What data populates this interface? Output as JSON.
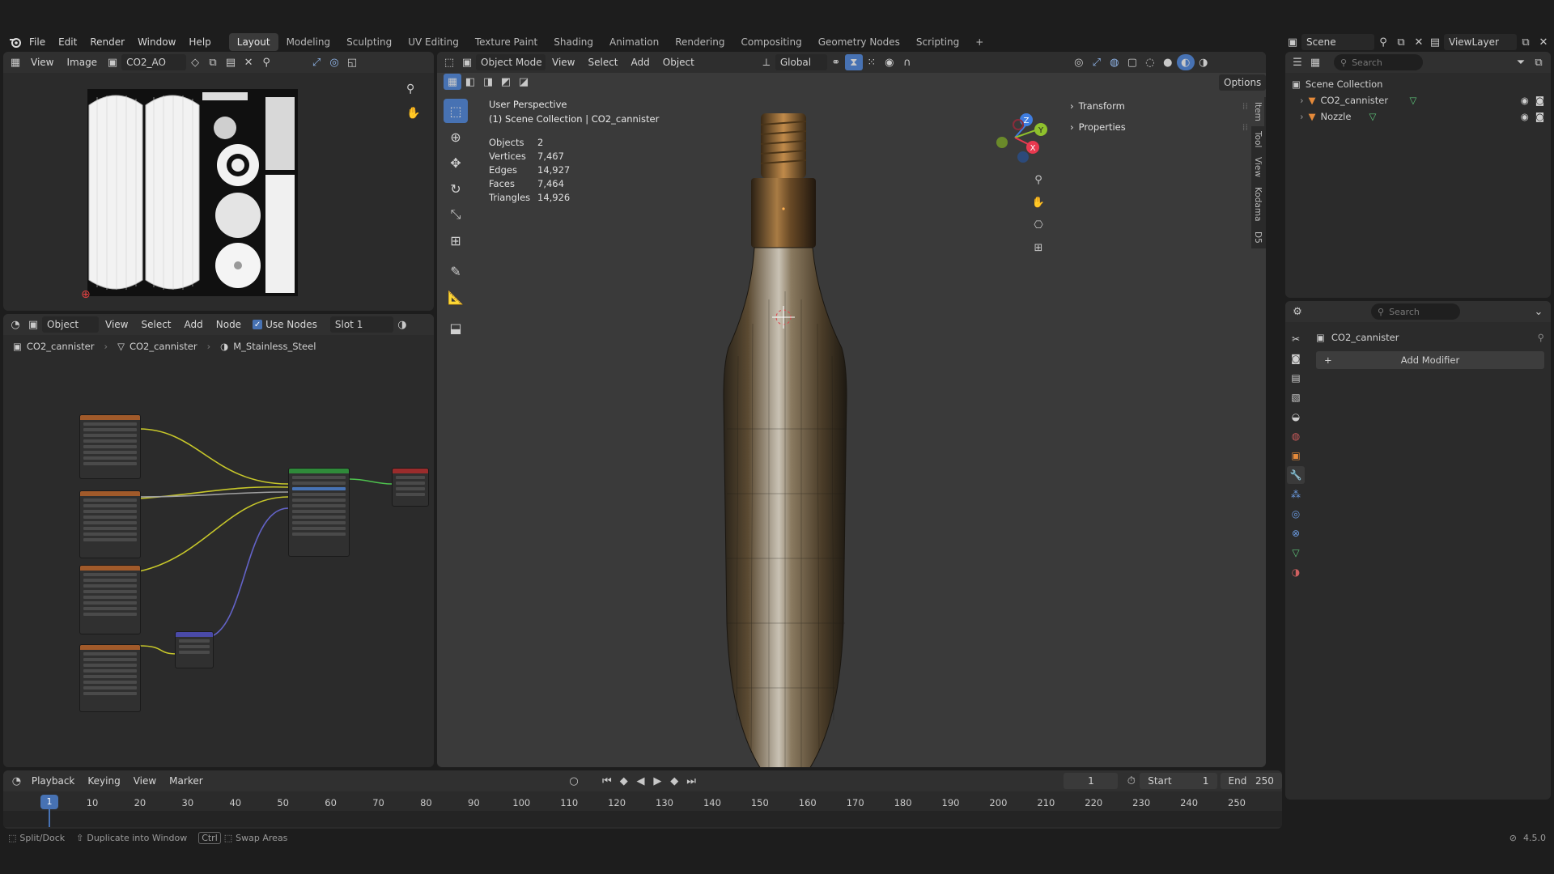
{
  "topbar": {
    "menus": [
      "File",
      "Edit",
      "Render",
      "Window",
      "Help"
    ],
    "workspaces": [
      "Layout",
      "Modeling",
      "Sculpting",
      "UV Editing",
      "Texture Paint",
      "Shading",
      "Animation",
      "Rendering",
      "Compositing",
      "Geometry Nodes",
      "Scripting"
    ],
    "active_workspace": "Layout",
    "scene_label": "Scene",
    "viewlayer_label": "ViewLayer"
  },
  "image_editor": {
    "menus": [
      "View",
      "Image"
    ],
    "image_name": "CO2_AO"
  },
  "node_editor": {
    "object_mode": "Object",
    "menus": [
      "View",
      "Select",
      "Add",
      "Node"
    ],
    "use_nodes_label": "Use Nodes",
    "use_nodes_checked": true,
    "slot": "Slot 1",
    "breadcrumb": [
      "CO2_cannister",
      "CO2_cannister",
      "M_Stainless_Steel"
    ]
  },
  "viewport": {
    "mode": "Object Mode",
    "menus": [
      "View",
      "Select",
      "Add",
      "Object"
    ],
    "transform_orientation": "Global",
    "options_label": "Options",
    "perspective_label": "User Perspective",
    "collection_label": "(1) Scene Collection | CO2_cannister",
    "stats": [
      {
        "label": "Objects",
        "value": "2"
      },
      {
        "label": "Vertices",
        "value": "7,467"
      },
      {
        "label": "Edges",
        "value": "14,927"
      },
      {
        "label": "Faces",
        "value": "7,464"
      },
      {
        "label": "Triangles",
        "value": "14,926"
      }
    ],
    "n_panel": [
      "Transform",
      "Properties"
    ],
    "side_tabs": [
      "Item",
      "Tool",
      "View",
      "Kodama",
      "D5"
    ],
    "gizmo_axes": [
      "Z",
      "Y",
      "X"
    ]
  },
  "outliner": {
    "search_placeholder": "Search",
    "root": "Scene Collection",
    "items": [
      "CO2_cannister",
      "Nozzle"
    ]
  },
  "properties": {
    "search_placeholder": "Search",
    "object_name": "CO2_cannister",
    "add_modifier_label": "Add Modifier"
  },
  "timeline": {
    "menus": [
      "Playback",
      "Keying",
      "View",
      "Marker"
    ],
    "current_frame": "1",
    "start_label": "Start",
    "start_value": "1",
    "end_label": "End",
    "end_value": "250",
    "ticks": [
      "1",
      "10",
      "20",
      "30",
      "40",
      "50",
      "60",
      "70",
      "80",
      "90",
      "100",
      "110",
      "120",
      "130",
      "140",
      "150",
      "160",
      "170",
      "180",
      "190",
      "200",
      "210",
      "220",
      "230",
      "240",
      "250"
    ]
  },
  "statusbar": {
    "items": [
      "Split/Dock",
      "Duplicate into Window",
      "Ctrl",
      "Swap Areas"
    ],
    "version": "4.5.0"
  },
  "colors": {
    "accent": "#4772b3",
    "axis_x": "#e8394f",
    "axis_y": "#8fc12d",
    "axis_z": "#3f7de0",
    "object_orange": "#e58a3a",
    "mesh_green": "#5ec47a"
  }
}
